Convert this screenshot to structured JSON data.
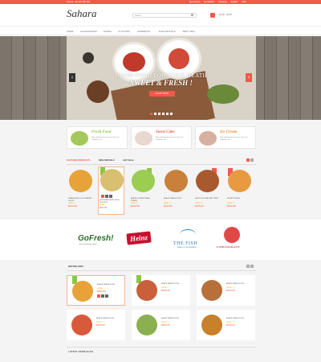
{
  "topbar": {
    "phone": "Call us: +00 123 456 789",
    "links": [
      "My Account",
      "My Wishlist",
      "Checkout",
      "English",
      "USD"
    ]
  },
  "header": {
    "logo": "Sahara",
    "search_placeholder": "Search",
    "cart": "Cart(0) - $0.00"
  },
  "nav": {
    "items": [
      "HOME",
      "ACCESSORIES",
      "SHOES",
      "CLOTHING",
      "HANDBAGS",
      "ELECTRONICS",
      "BEST SELL"
    ]
  },
  "hero": {
    "line1": "GOOD FOOD FOR YOUR HEATH",
    "line2": "SWEET & FRESH !",
    "button": "SHOP NOW",
    "prev": "‹",
    "next": "›"
  },
  "promos": [
    {
      "title": "Fresh Food",
      "desc": "Nam pellentesque pretium velit, nec molestie eros",
      "color": "#8dc63f"
    },
    {
      "title": "Sweet Cake",
      "desc": "Nam pellentesque pretium velit, nec molestie eros",
      "color": "#f05a4a"
    },
    {
      "title": "Ice Cream",
      "desc": "Nam pellentesque pretium velit, nec molestie eros",
      "color": "#f08a24"
    }
  ],
  "featured": {
    "tabs": [
      "FEATURED PRODUCTS",
      "NEW ARRIVALS",
      "HOT SALE"
    ],
    "products": [
      {
        "name": "DARE BLACK GOLD PATENT GUCCI",
        "price": "$222.99",
        "stars": "★★★☆☆",
        "color": "#e8a23a"
      },
      {
        "name": "DESIGNER SHIRT WITH POCKETS",
        "price": "$69.99",
        "stars": "★★★☆☆",
        "color": "#d8c070"
      },
      {
        "name": "BLACK & WHITE MESH STRIPE",
        "price": "$222.99",
        "stars": "★★★☆☆",
        "color": "#9acd50"
      },
      {
        "name": "BLACK DRESS FOOD",
        "price": "$212.99",
        "stars": "★★★☆☆",
        "color": "#c8803a"
      },
      {
        "name": "BLACK DOLORE SED TEMP",
        "price": "$115.00",
        "stars": "★★★☆☆",
        "color": "#a85a2e"
      },
      {
        "name": "SHORTS SHOE",
        "price": "$222.99",
        "stars": "★★★☆☆",
        "color": "#e89a40"
      }
    ]
  },
  "brands": {
    "gofresh": "GoFresh!",
    "gofresh_sub": "great ingredients always",
    "heinz": "Heinz",
    "fish": "THE FISH",
    "fish_sub": "SEAFOOD RESTAURANT",
    "lobster": "LOBSTAURANT"
  },
  "bestsellers": {
    "title": "BESTSELLERS",
    "items": [
      {
        "name": "BLACK DRESS FOOD",
        "price": "$200.00",
        "stars": "★★★☆☆",
        "color": "#e8a23a"
      },
      {
        "name": "BLACK DRESS FOOD",
        "price": "$200.00",
        "stars": "★★★☆☆",
        "color": "#c8603a"
      },
      {
        "name": "BLACK DRESS FOOD",
        "price": "$200.00",
        "stars": "★★★☆☆",
        "color": "#b8703a"
      },
      {
        "name": "BLACK DRESS FOOD",
        "price": "$200.00",
        "stars": "★★★☆☆",
        "color": "#d85a3a"
      },
      {
        "name": "BLACK DRESS FOOD",
        "price": "$200.00",
        "stars": "★★★☆☆",
        "color": "#8ab050"
      },
      {
        "name": "BLACK DRESS FOOD",
        "price": "$200.00",
        "stars": "★★★☆☆",
        "color": "#c8802a"
      }
    ]
  },
  "blog": {
    "title": "LATEST FROM BLOG"
  },
  "colors": {
    "accent": "#f05a4a",
    "green": "#8dc63f"
  }
}
